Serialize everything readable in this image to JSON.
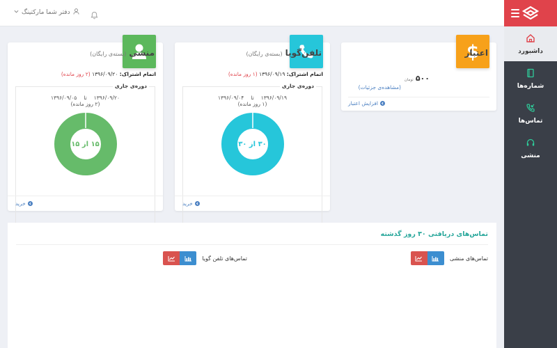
{
  "topbar": {
    "office_label": "دفتر شما مارکتینگ"
  },
  "sidebar": {
    "items": [
      {
        "label": "داشبورد",
        "icon": "home-icon"
      },
      {
        "label": "شماره‌ها",
        "icon": "book-icon"
      },
      {
        "label": "تماس‌ها",
        "icon": "phone-incoming-icon"
      },
      {
        "label": "منشی",
        "icon": "headset-icon"
      }
    ]
  },
  "credit": {
    "title": "اعتبار",
    "amount": "۵۰۰",
    "unit": "تومان",
    "details": "(مشاهده‌ی جزئیات)",
    "increase": "افزایش اعتبار",
    "color": "#f7a11a"
  },
  "phone": {
    "title": "تلفن‌گویا",
    "plan": "(بسته‌ی رایگان)",
    "expiry_label": "اتمام اشتراک:",
    "expiry_date": "۱۳۹۶/۰۹/۱۹",
    "expiry_remaining": "(۱ روز مانده)",
    "period_label": "دوره‌ی جاری",
    "start": "۱۳۹۶/۰۹/۱۹",
    "to": "تا",
    "end": "۱۳۹۶/۰۹/۰۴",
    "days": "(۱ روز مانده)",
    "donut_text": "۳۰ از ۳۰",
    "buy": "خرید",
    "color": "#26c6da"
  },
  "secretary": {
    "title": "منشی",
    "plan": "(بسته‌ی رایگان)",
    "expiry_label": "اتمام اشتراک:",
    "expiry_date": "۱۳۹۶/۰۹/۲۰",
    "expiry_remaining": "(۲ روز مانده)",
    "period_label": "دوره‌ی جاری",
    "start": "۱۳۹۶/۰۹/۲۰",
    "to": "تا",
    "end": "۱۳۹۶/۰۹/۰۵",
    "days": "(۲ روز مانده)",
    "donut_text": "۱۵ از ۱۵",
    "buy": "خرید",
    "color": "#66bb6a"
  },
  "calls": {
    "title": "تماس‌های دریافتی ۳۰ روز گذشته",
    "secretary_label": "تماس‌های منشی",
    "phone_label": "تماس‌های تلفن گویا"
  }
}
